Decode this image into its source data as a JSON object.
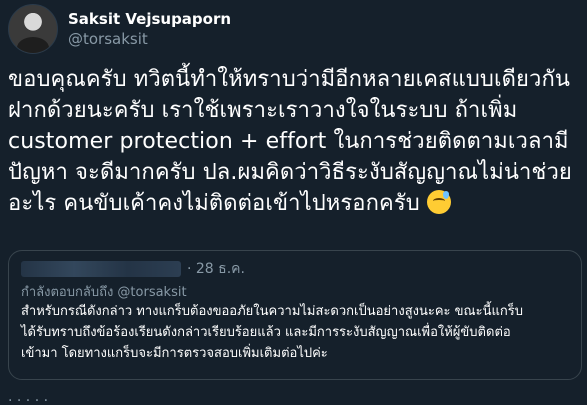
{
  "author": {
    "display_name": "Saksit Vejsupaporn",
    "handle": "@torsaksit"
  },
  "tweet": {
    "text": "ขอบคุณครับ ทวิตนี้ทำให้ทราบว่ามีอีกหลายเคสแบบเดียวกัน\nฝากด้วยนะครับ เราใช้เพราะเราวางใจในระบบ ถ้าเพิ่ม\ncustomer protection + effort ในการช่วยติดตามเวลามี\nปัญหา จะดีมากครับ ปล.ผมคิดว่าวิธีระงับสัญญาณไม่น่าช่วย\nอะไร คนขับเค้าคงไม่ติดต่อเข้าไปหรอกครับ",
    "emoji": "sweat-smile"
  },
  "quoted": {
    "date": "· 28 ธ.ค.",
    "replying_to": "กำลังตอบกลับถึง @torsaksit",
    "text": "สำหรับกรณีดังกล่าว ทางแกร็บต้องขออภัยในความไม่สะดวกเป็นอย่างสูงนะคะ ขณะนี้แกร็บ\nได้รับทราบถึงข้อร้องเรียนดังกล่าวเรียบร้อยแล้ว และมีการระงับสัญญาณเพื่อให้ผู้ขับติดต่อ\nเข้ามา โดยทางแกร็บจะมีการตรวจสอบเพิ่มเติมต่อไปค่ะ"
  },
  "colors": {
    "background": "#15202b",
    "secondary_text": "#8899a6",
    "border": "#38444d"
  }
}
